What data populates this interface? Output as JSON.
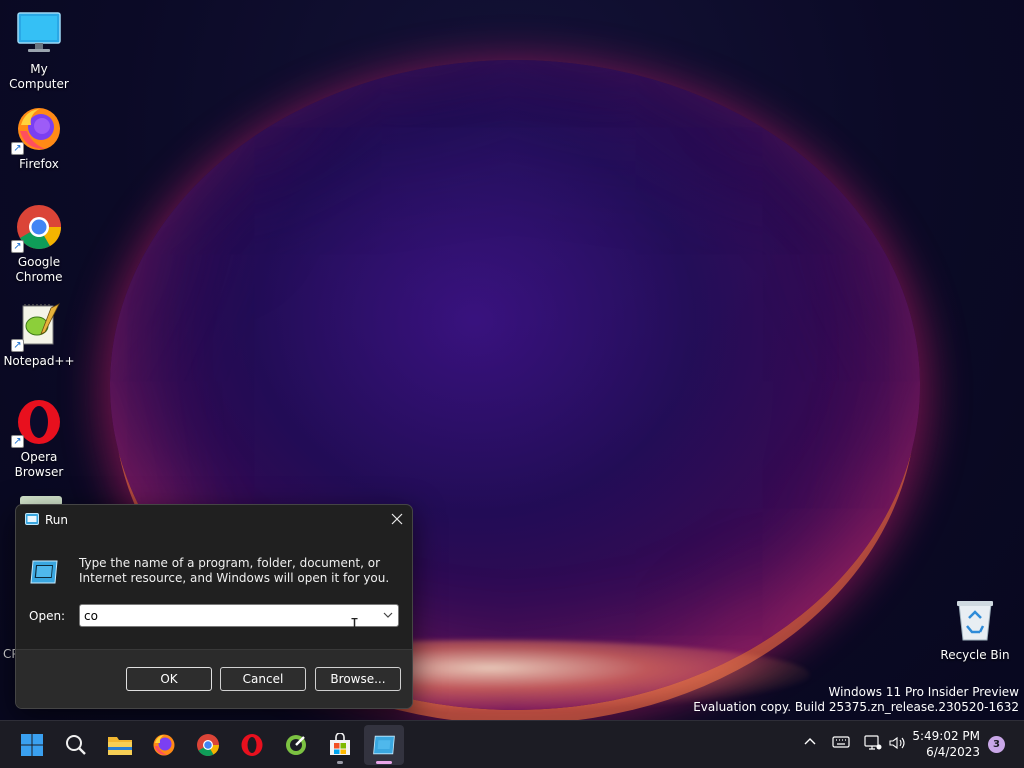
{
  "desktop": {
    "icons": [
      {
        "label": "My Computer"
      },
      {
        "label": "Firefox"
      },
      {
        "label": "Google Chrome",
        "line1": "Google",
        "line2": "Chrome"
      },
      {
        "label": "Notepad++"
      },
      {
        "label": "Opera Browser",
        "line1": "Opera",
        "line2": "Browser"
      },
      {
        "label": "Recycle Bin"
      }
    ],
    "partial_label": "CP"
  },
  "watermark": {
    "line1": "Windows 11 Pro Insider Preview",
    "line2": "Evaluation copy. Build 25375.zn_release.230520-1632"
  },
  "run_dialog": {
    "title": "Run",
    "description": "Type the name of a program, folder, document, or Internet resource, and Windows will open it for you.",
    "open_label": "Open:",
    "input_value": "co",
    "ok_label": "OK",
    "cancel_label": "Cancel",
    "browse_label": "Browse..."
  },
  "taskbar": {
    "apps": [
      "start-icon",
      "search-icon",
      "file-explorer-icon",
      "firefox-icon",
      "chrome-icon",
      "opera-icon",
      "cpu-z-icon",
      "microsoft-store-icon",
      "run-icon"
    ],
    "clock": {
      "time": "5:49:02 PM",
      "date": "6/4/2023"
    },
    "notification_count": "3"
  },
  "colors": {
    "dialog_bg": "#202020",
    "dialog_footer": "#2b2b2b",
    "taskbar_bg": "#1c1c24",
    "accent_run_icon": "#3aa7e0"
  }
}
